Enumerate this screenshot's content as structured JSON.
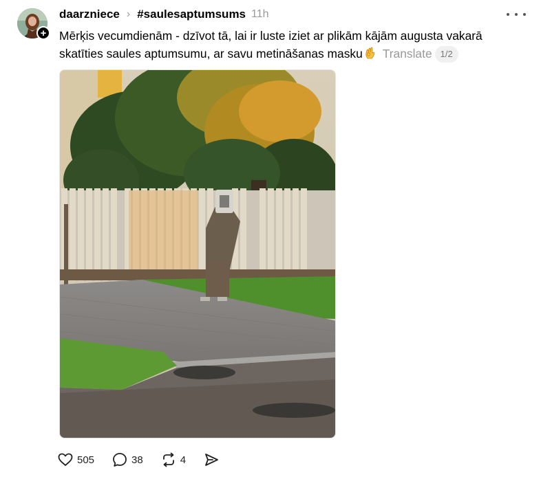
{
  "post": {
    "username": "daarzniece",
    "tag": "#saulesaptumsums",
    "time": "11h",
    "text_part1": "Mērķis vecumdienām - dzīvot tā, lai ir luste iziet ar plikām kājām augusta vakarā skatīties saules aptumsumu, ar savu metināšanas masku",
    "emoji": "ok-hand-emoji",
    "translate_label": "Translate",
    "pager": "1/2"
  },
  "actions": {
    "likes": "505",
    "comments": "38",
    "reposts": "4"
  },
  "icons": {
    "like": "heart-icon",
    "comment": "comment-bubble-icon",
    "repost": "repost-arrows-icon",
    "share": "send-paper-plane-icon",
    "more": "more-dots-icon"
  },
  "colors": {
    "muted": "#999999",
    "text": "#000000",
    "pager_bg": "#f0f0f0"
  }
}
